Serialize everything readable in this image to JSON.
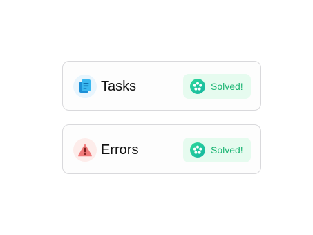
{
  "cards": [
    {
      "title": "Tasks",
      "icon": "documents-icon",
      "status": {
        "label": "Solved!",
        "icon": "flower-check-icon"
      }
    },
    {
      "title": "Errors",
      "icon": "warning-triangle-icon",
      "status": {
        "label": "Solved!",
        "icon": "flower-check-icon"
      }
    }
  ],
  "colors": {
    "tasks_icon": "#29a7e8",
    "tasks_icon_bg": "#e8f5fd",
    "errors_icon": "#f07a7a",
    "errors_icon_bg": "#fdecea",
    "status_text": "#1db574",
    "status_bg": "#e6fbef"
  }
}
